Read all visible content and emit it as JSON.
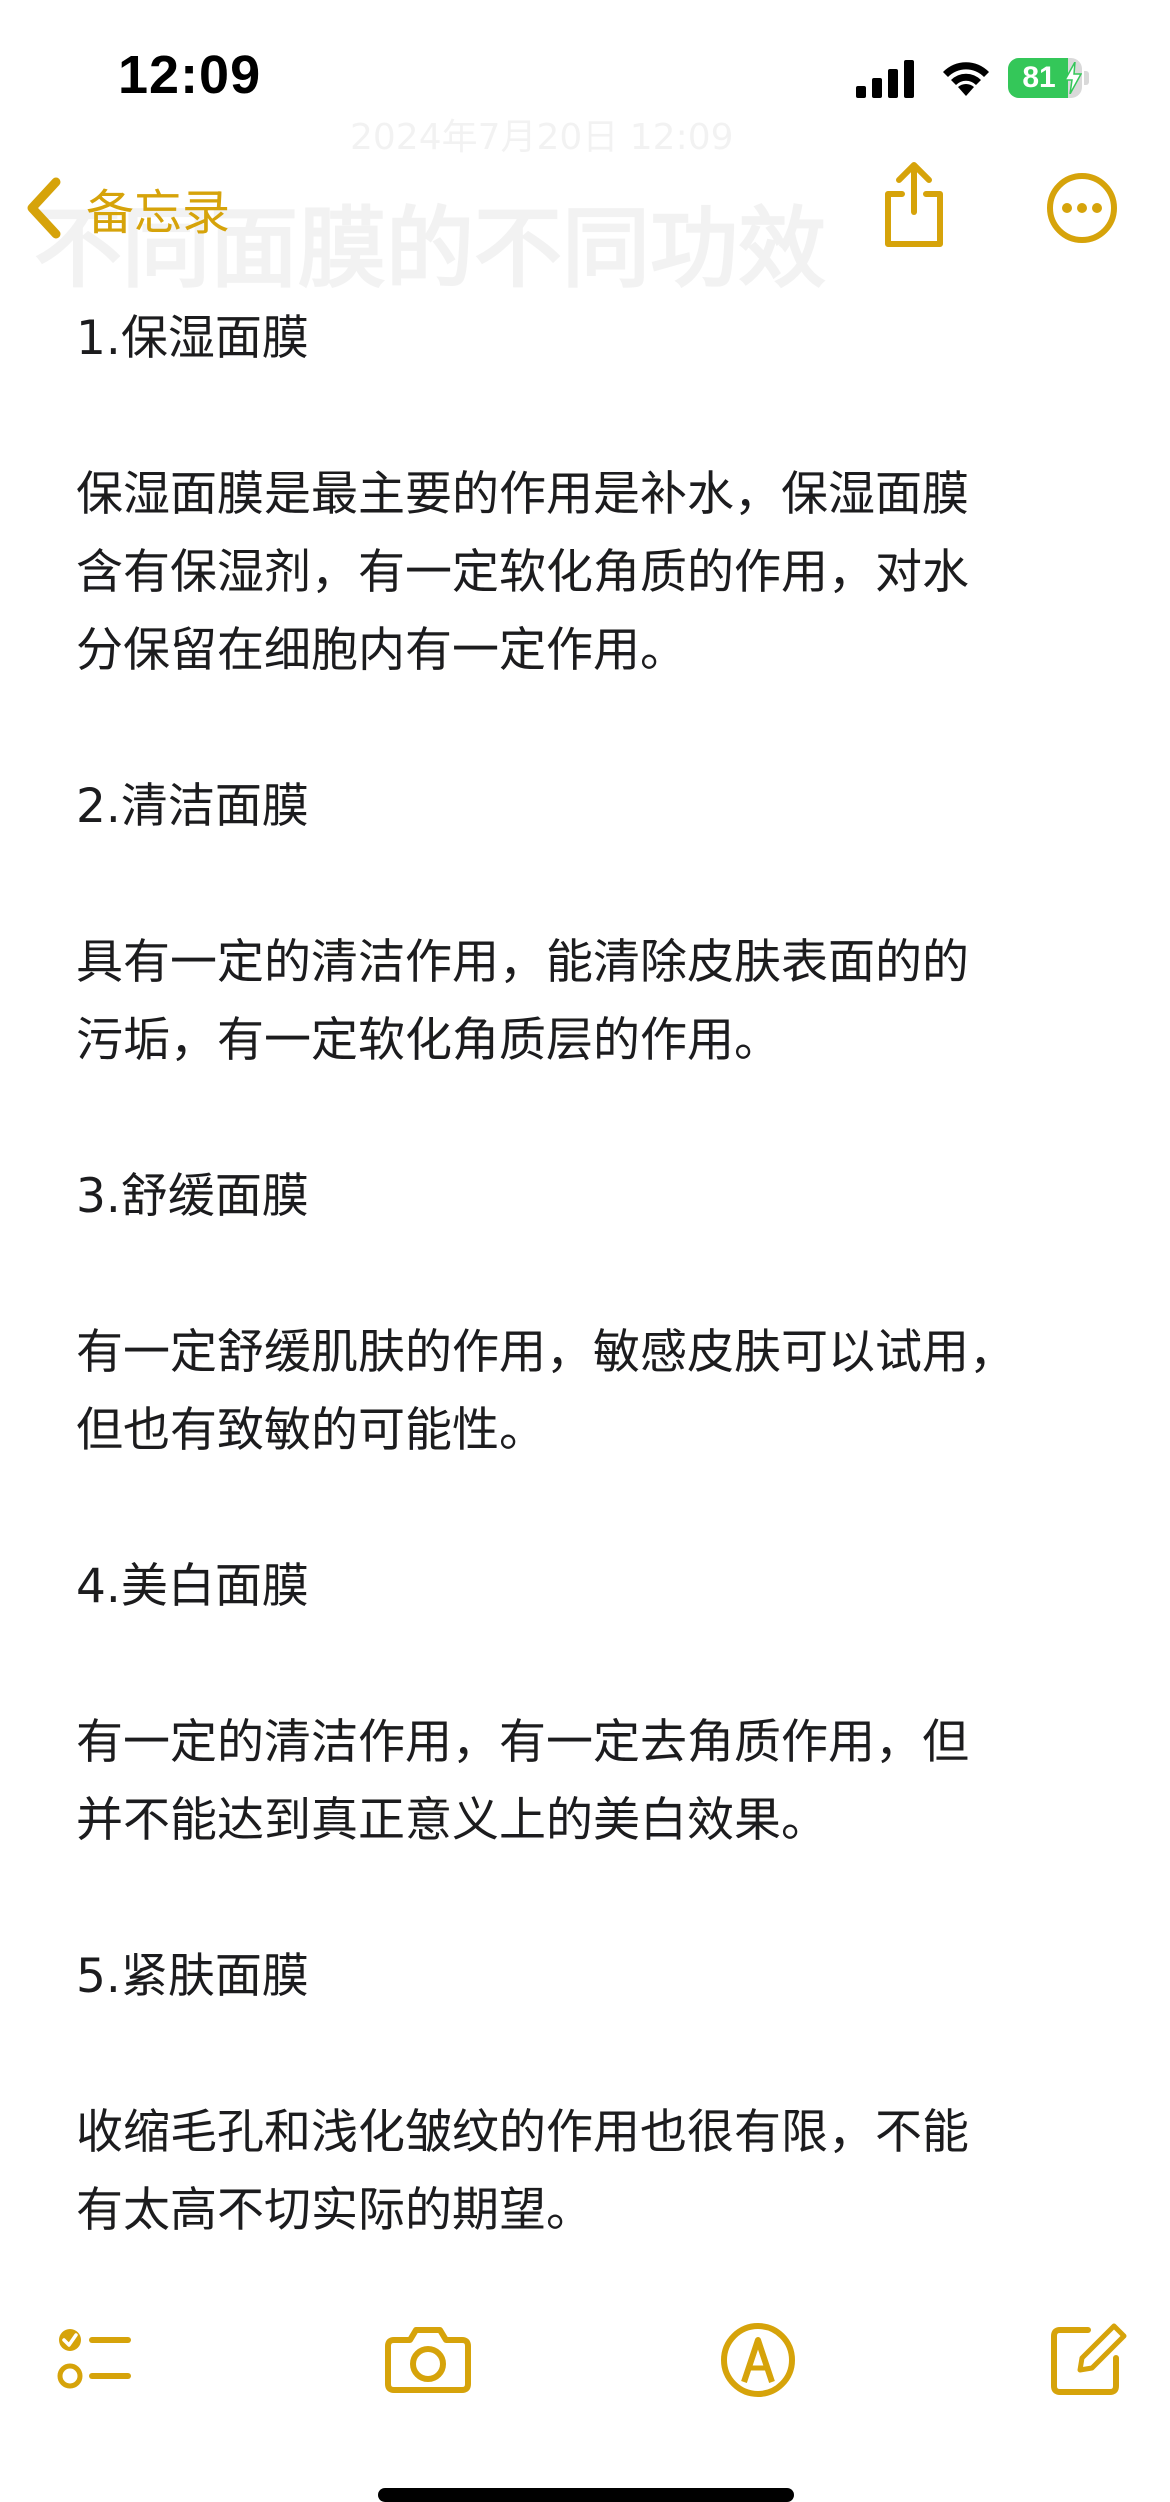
{
  "status_bar": {
    "time": "12:09",
    "battery_level": "81",
    "battery_fraction": 0.81,
    "icons": [
      "signal-icon",
      "wifi-icon",
      "battery-icon",
      "charging-bolt-icon"
    ]
  },
  "nav": {
    "back_label": "备忘录",
    "icons": [
      "back-chevron-icon",
      "share-icon",
      "more-ellipsis-icon"
    ],
    "accent_color": "#d6a30a"
  },
  "ghost": {
    "subtitle": "2024年7月20日 12:09",
    "title": "不同面膜的不同功效"
  },
  "note": {
    "lines": [
      "1.保湿面膜",
      "保湿面膜是最主要的作用是补水，保湿面膜",
      "含有保湿剂，有一定软化角质的作用，对水",
      "分保留在细胞内有一定作用。",
      "2.清洁面膜",
      "具有一定的清洁作用，能清除皮肤表面的的",
      "污垢，有一定软化角质层的作用。",
      "3.舒缓面膜",
      "有一定舒缓肌肤的作用，敏感皮肤可以试用，",
      "但也有致敏的可能性。",
      "4.美白面膜",
      "有一定的清洁作用，有一定去角质作用，但",
      "并不能达到真正意义上的美白效果。",
      "5.紧肤面膜",
      "收缩毛孔和浅化皱纹的作用也很有限，不能",
      "有太高不切实际的期望。"
    ]
  },
  "toolbar": {
    "icons": [
      "checklist-icon",
      "camera-icon",
      "markup-pen-icon",
      "compose-icon"
    ]
  }
}
